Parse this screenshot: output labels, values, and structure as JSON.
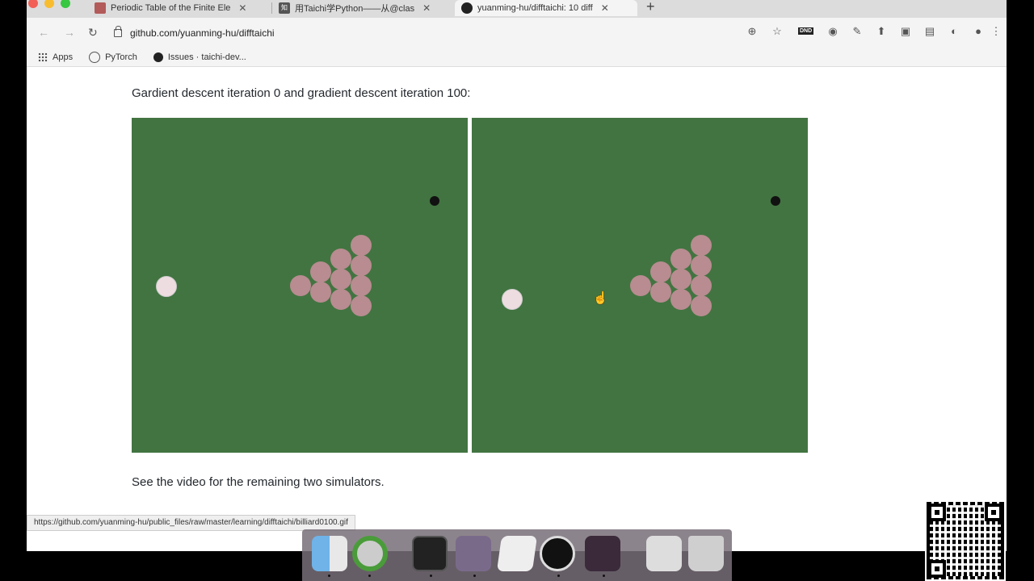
{
  "tabs": [
    {
      "title": "Periodic Table of the Finite Ele",
      "favicon_color": "#b35a5a"
    },
    {
      "title": "用Taichi学Python——从@clas",
      "favicon_color": "#555555"
    },
    {
      "title": "yuanming-hu/difftaichi: 10 diff",
      "favicon_color": "#222222"
    }
  ],
  "toolbar": {
    "url": "github.com/yuanming-hu/difftaichi",
    "dnd_badge": "DND"
  },
  "bookmarks": [
    {
      "label": "Apps",
      "icon": "apps-grid-icon"
    },
    {
      "label": "PyTorch",
      "icon": "pytorch-icon"
    },
    {
      "label": "Issues · taichi-dev...",
      "icon": "github-icon"
    }
  ],
  "content": {
    "caption": "Gardient descent iteration 0 and gradient descent iteration 100:",
    "footer": "See the video for the remaining two simulators."
  },
  "status_url": "https://github.com/yuanming-hu/public_files/raw/master/learning/difftaichi/billiard0100.gif",
  "colors": {
    "table_green": "#427441",
    "ball_pink": "#b88c90",
    "cue_ball": "#eedde0",
    "target": "#111111"
  },
  "dock": {
    "apps": [
      "finder-icon",
      "chrome-icon",
      "terminal-icon",
      "keynote-icon",
      "pages-icon",
      "obs-icon",
      "activity-monitor-icon",
      "preview-icon",
      "trash-icon"
    ]
  }
}
